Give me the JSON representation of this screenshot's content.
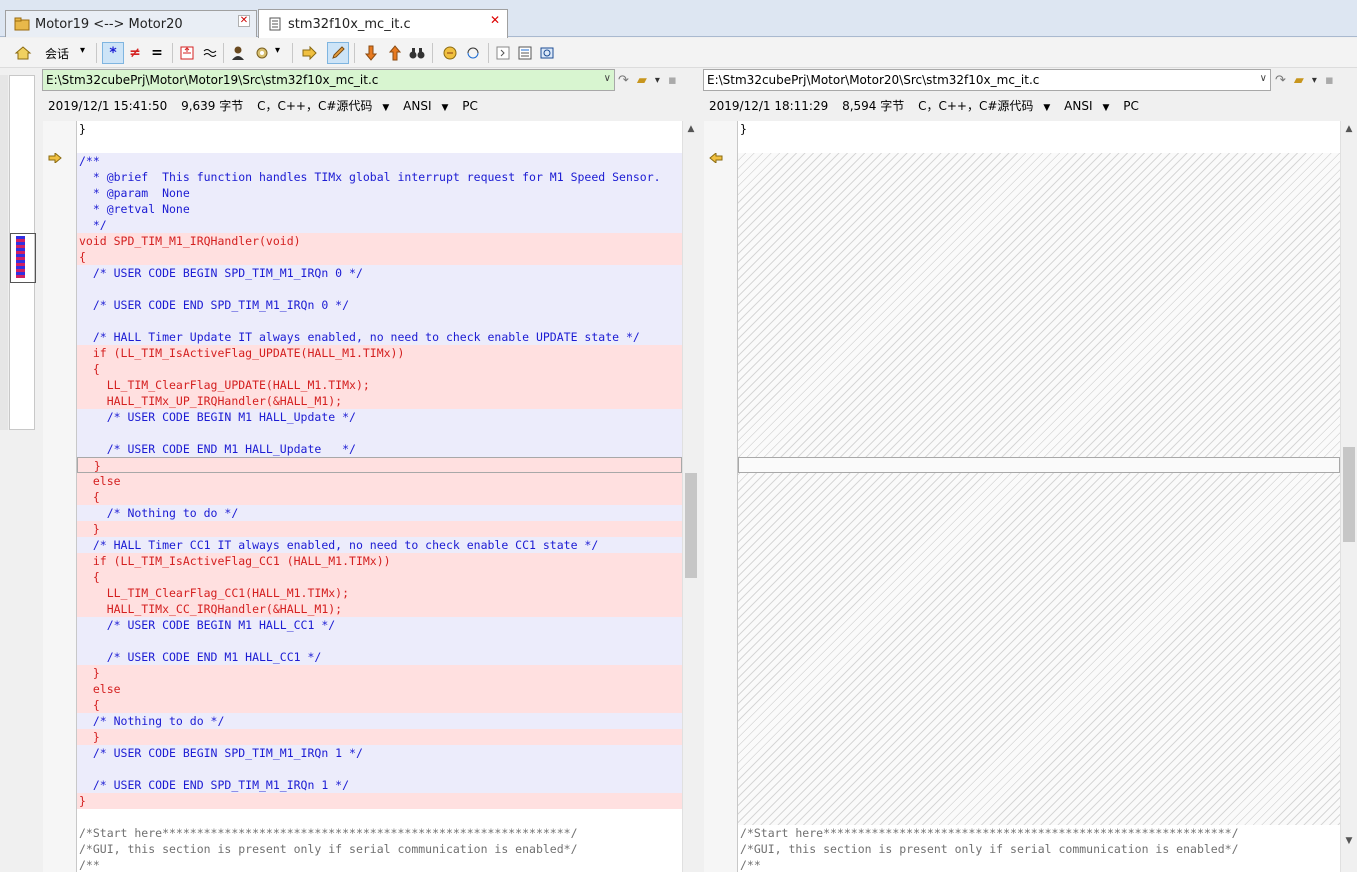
{
  "tabs": [
    {
      "label": "Motor19 <--> Motor20",
      "close": "✕"
    },
    {
      "label": "stm32f10x_mc_it.c",
      "close": "✕"
    }
  ],
  "toolbar": {
    "session_label": "会话",
    "session_arrow": "▾",
    "all_label": "*",
    "diffs_label": "≠",
    "same_label": "="
  },
  "left": {
    "path": "E:\\Stm32cubePrj\\Motor\\Motor19\\Src\\stm32f10x_mc_it.c",
    "date": "2019/12/1 15:41:50",
    "size": "9,639 字节",
    "format": "C，C++，C#源代码",
    "encoding": "ANSI",
    "lineend": "PC",
    "lines": [
      {
        "t": "}",
        "c": "eq",
        "bg": "none"
      },
      {
        "t": "",
        "c": "eq",
        "bg": "none"
      },
      {
        "t": "/**",
        "c": "cm",
        "bg": "mov"
      },
      {
        "t": "  * @brief  This function handles TIMx global interrupt request for M1 Speed Sensor.",
        "c": "cm",
        "bg": "mov"
      },
      {
        "t": "  * @param  None",
        "c": "cm",
        "bg": "mov"
      },
      {
        "t": "  * @retval None",
        "c": "cm",
        "bg": "mov"
      },
      {
        "t": "  */",
        "c": "cm",
        "bg": "mov"
      },
      {
        "t": "void SPD_TIM_M1_IRQHandler(void)",
        "c": "df",
        "bg": "diff"
      },
      {
        "t": "{",
        "c": "df",
        "bg": "diff"
      },
      {
        "t": "  /* USER CODE BEGIN SPD_TIM_M1_IRQn 0 */",
        "c": "cm",
        "bg": "mov"
      },
      {
        "t": "",
        "c": "cm",
        "bg": "mov"
      },
      {
        "t": "  /* USER CODE END SPD_TIM_M1_IRQn 0 */",
        "c": "cm",
        "bg": "mov"
      },
      {
        "t": "",
        "c": "cm",
        "bg": "mov"
      },
      {
        "t": "  /* HALL Timer Update IT always enabled, no need to check enable UPDATE state */",
        "c": "cm",
        "bg": "mov"
      },
      {
        "t": "  if (LL_TIM_IsActiveFlag_UPDATE(HALL_M1.TIMx))",
        "c": "df",
        "bg": "diff"
      },
      {
        "t": "  {",
        "c": "df",
        "bg": "diff"
      },
      {
        "t": "    LL_TIM_ClearFlag_UPDATE(HALL_M1.TIMx);",
        "c": "df",
        "bg": "diff"
      },
      {
        "t": "    HALL_TIMx_UP_IRQHandler(&HALL_M1);",
        "c": "df",
        "bg": "diff"
      },
      {
        "t": "    /* USER CODE BEGIN M1 HALL_Update */",
        "c": "cm",
        "bg": "mov"
      },
      {
        "t": "",
        "c": "cm",
        "bg": "mov"
      },
      {
        "t": "    /* USER CODE END M1 HALL_Update   */",
        "c": "cm",
        "bg": "mov"
      },
      {
        "t": "  }",
        "c": "df",
        "bg": "diff"
      },
      {
        "t": "  else",
        "c": "df",
        "bg": "diff"
      },
      {
        "t": "  {",
        "c": "df",
        "bg": "diff"
      },
      {
        "t": "    /* Nothing to do */",
        "c": "cm",
        "bg": "mov"
      },
      {
        "t": "  }",
        "c": "df",
        "bg": "diff"
      },
      {
        "t": "  /* HALL Timer CC1 IT always enabled, no need to check enable CC1 state */",
        "c": "cm",
        "bg": "mov"
      },
      {
        "t": "  if (LL_TIM_IsActiveFlag_CC1 (HALL_M1.TIMx))",
        "c": "df",
        "bg": "diff"
      },
      {
        "t": "  {",
        "c": "df",
        "bg": "diff"
      },
      {
        "t": "    LL_TIM_ClearFlag_CC1(HALL_M1.TIMx);",
        "c": "df",
        "bg": "diff"
      },
      {
        "t": "    HALL_TIMx_CC_IRQHandler(&HALL_M1);",
        "c": "df",
        "bg": "diff"
      },
      {
        "t": "    /* USER CODE BEGIN M1 HALL_CC1 */",
        "c": "cm",
        "bg": "mov"
      },
      {
        "t": "",
        "c": "cm",
        "bg": "mov"
      },
      {
        "t": "    /* USER CODE END M1 HALL_CC1 */",
        "c": "cm",
        "bg": "mov"
      },
      {
        "t": "  }",
        "c": "df",
        "bg": "diff"
      },
      {
        "t": "  else",
        "c": "df",
        "bg": "diff"
      },
      {
        "t": "  {",
        "c": "df",
        "bg": "diff"
      },
      {
        "t": "  /* Nothing to do */",
        "c": "cm",
        "bg": "mov"
      },
      {
        "t": "  }",
        "c": "df",
        "bg": "diff"
      },
      {
        "t": "  /* USER CODE BEGIN SPD_TIM_M1_IRQn 1 */",
        "c": "cm",
        "bg": "mov"
      },
      {
        "t": "",
        "c": "cm",
        "bg": "mov"
      },
      {
        "t": "  /* USER CODE END SPD_TIM_M1_IRQn 1 */",
        "c": "cm",
        "bg": "mov"
      },
      {
        "t": "}",
        "c": "df",
        "bg": "diff"
      },
      {
        "t": "",
        "c": "eq",
        "bg": "none"
      },
      {
        "t": "/*Start here***********************************************************/",
        "c": "gray",
        "bg": "none"
      },
      {
        "t": "/*GUI, this section is present only if serial communication is enabled*/",
        "c": "gray",
        "bg": "none"
      },
      {
        "t": "/**",
        "c": "gray",
        "bg": "none"
      }
    ]
  },
  "right": {
    "path": "E:\\Stm32cubePrj\\Motor\\Motor20\\Src\\stm32f10x_mc_it.c",
    "date": "2019/12/1 18:11:29",
    "size": "8,594 字节",
    "format": "C，C++，C#源代码",
    "encoding": "ANSI",
    "lineend": "PC",
    "top_line": "}",
    "bottom_lines": [
      "/*Start here***********************************************************/",
      "/*GUI, this section is present only if serial communication is enabled*/",
      "/**"
    ]
  },
  "colors": {
    "diff_bg": "#ffe0e0",
    "moved_bg": "#ececfb",
    "diff_text": "#d42020",
    "comment_text": "#1b1bd3",
    "left_path_bg": "#d8f5d0"
  },
  "icons": [
    "folder-session-icon",
    "file-c-icon",
    "close-icon",
    "home-icon",
    "show-all-icon",
    "show-diffs-icon",
    "show-same-icon",
    "insert-diff-icon",
    "approx-icon",
    "person-icon",
    "rules-icon",
    "next-icon",
    "edit-icon",
    "prev-diff-icon",
    "next-diff-icon",
    "binoculars-icon",
    "swap-icon",
    "sync-icon",
    "expand-icon",
    "list-icon",
    "refresh-icon",
    "open-folder-icon",
    "save-icon"
  ]
}
